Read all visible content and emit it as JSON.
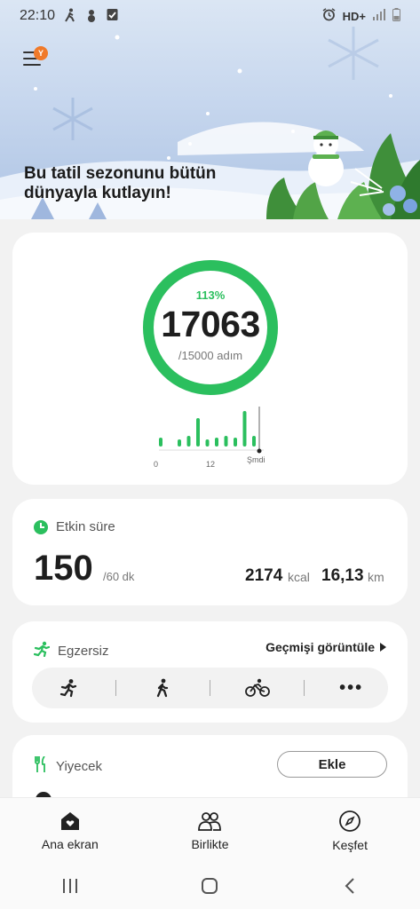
{
  "status_bar": {
    "time": "22:10",
    "network": "HD+"
  },
  "banner": {
    "badge": "Y",
    "text_line1": "Bu tatil sezonunu bütün",
    "text_line2": "dünyayla kutlayın!"
  },
  "steps": {
    "percent": "113%",
    "count": "17063",
    "goal": "/15000 adım",
    "progress_fraction": 1.0,
    "accent_color": "#2bbf5e",
    "chart_ticks": [
      "0",
      "12",
      "Şmdi"
    ],
    "hourly_levels": [
      0.25,
      0,
      0.2,
      0.3,
      0.8,
      0.2,
      0.25,
      0.3,
      0.25,
      1.0,
      0.3
    ]
  },
  "active_time": {
    "title": "Etkin süre",
    "minutes": "150",
    "goal": "/60 dk",
    "kcal_value": "2174",
    "kcal_unit": "kcal",
    "km_value": "16,13",
    "km_unit": "km"
  },
  "exercise": {
    "title": "Egzersiz",
    "history_link": "Geçmişi görüntüle",
    "buttons": [
      "running-icon",
      "walking-icon",
      "cycling-icon",
      "more-icon"
    ]
  },
  "food": {
    "title": "Yiyecek",
    "add_button": "Ekle"
  },
  "bottom_nav": {
    "home": "Ana ekran",
    "together": "Birlikte",
    "discover": "Keşfet"
  }
}
